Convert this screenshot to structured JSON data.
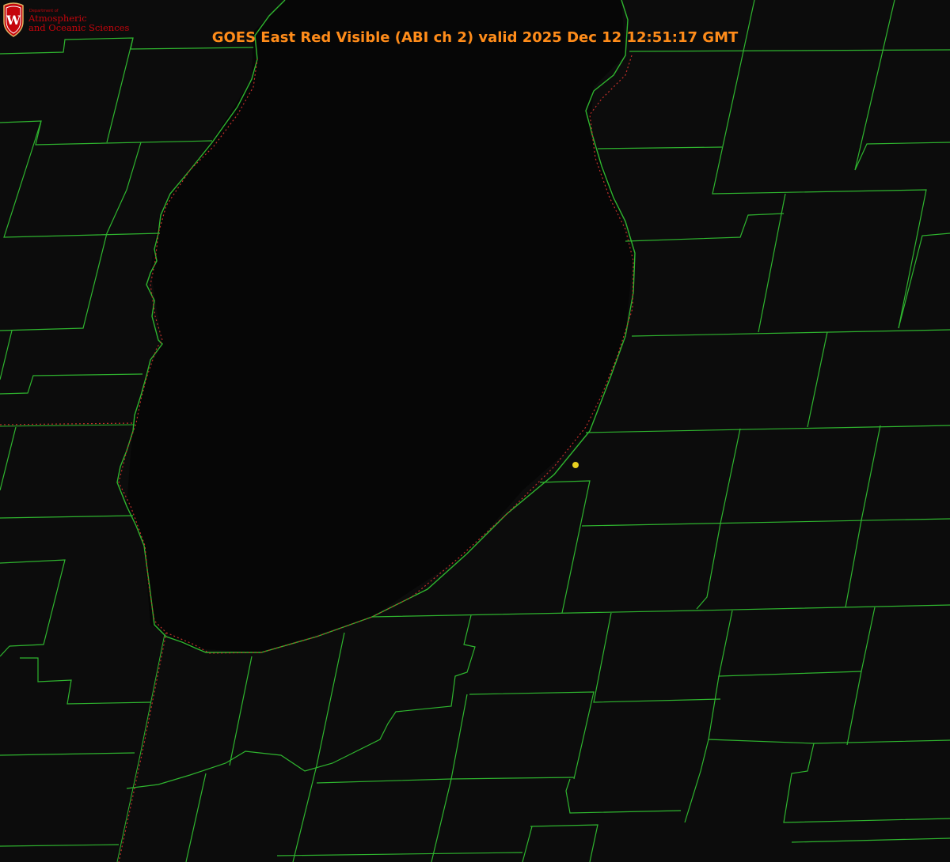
{
  "title": "GOES East Red Visible (ABI ch 2) valid 2025 Dec 12 12:51:17 GMT",
  "logo": {
    "department": "Department of",
    "line1": "Atmospheric",
    "line2": "and Oceanic Sciences",
    "shield_letter": "W",
    "icon": "uw-crest-icon"
  },
  "colors": {
    "background": "#0c0c0c",
    "county_border": "#2fb52f",
    "coastline": "#2fb52f",
    "state_border": "#c0302a",
    "title": "#ff8c1a",
    "logo": "#c5050c",
    "station_marker": "#e8d020"
  },
  "layers": [
    "county-borders",
    "lake-shoreline",
    "state-border",
    "station-marker"
  ]
}
